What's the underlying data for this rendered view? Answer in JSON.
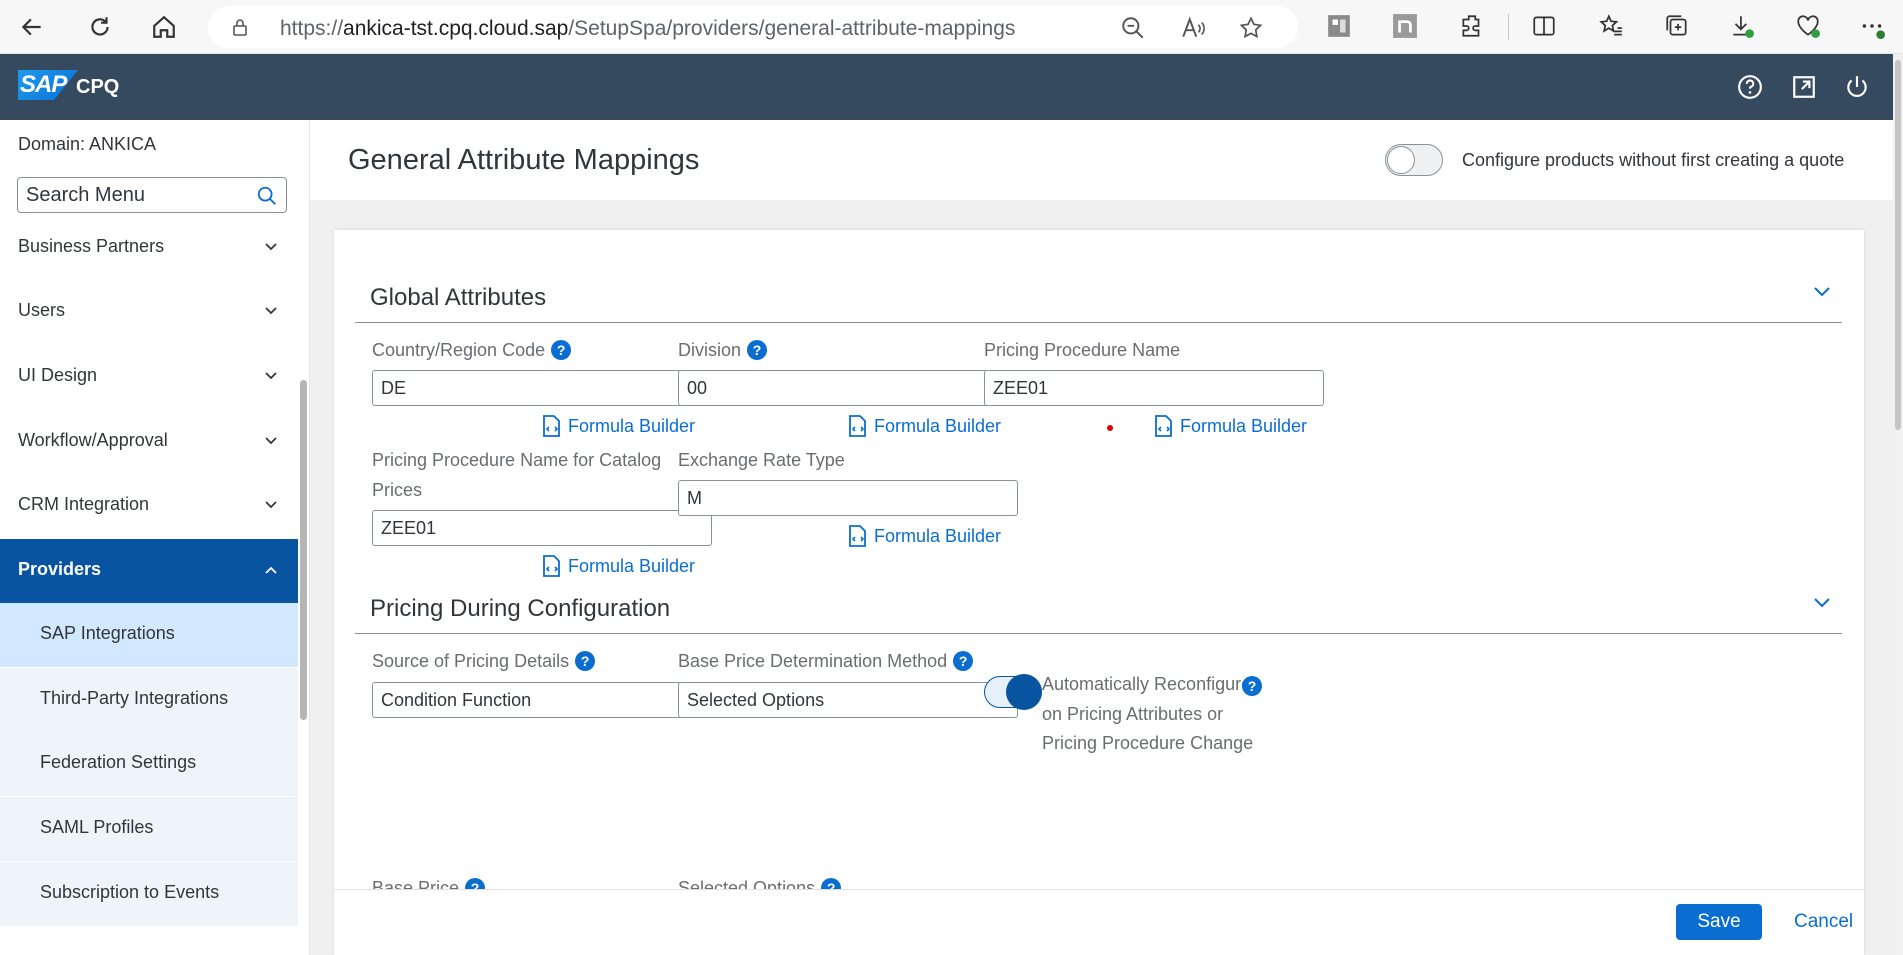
{
  "browser": {
    "url_prefix": "https://",
    "url_host": "ankica-tst.cpq.cloud.sap",
    "url_path": "/SetupSpa/providers/general-attribute-mappings"
  },
  "shell": {
    "logo": "SAP",
    "product": "CPQ"
  },
  "sidebar": {
    "domain": "Domain: ANKICA",
    "search_placeholder": "Search Menu",
    "items": [
      {
        "label": "Business Partners"
      },
      {
        "label": "Users"
      },
      {
        "label": "UI Design"
      },
      {
        "label": "Workflow/Approval"
      },
      {
        "label": "CRM Integration"
      },
      {
        "label": "Providers"
      },
      {
        "label": "SAP Integrations"
      },
      {
        "label": "Third-Party Integrations"
      },
      {
        "label": "Federation Settings"
      },
      {
        "label": "SAML Profiles"
      },
      {
        "label": "Subscription to Events"
      }
    ]
  },
  "main": {
    "title": "General Attribute Mappings",
    "configure_toggle_label": "Configure products without first creating a quote",
    "formula_builder": "Formula Builder",
    "global": {
      "title": "Global Attributes",
      "country_label": "Country/Region Code",
      "country_value": "DE",
      "division_label": "Division",
      "division_value": "00",
      "procedure_label": "Pricing Procedure Name",
      "procedure_value": "ZEE01",
      "catalog_label_1": "Pricing Procedure Name for Catalog",
      "catalog_label_2": "Prices",
      "catalog_value": "ZEE01",
      "exchange_label": "Exchange Rate Type",
      "exchange_value": "M"
    },
    "pricing": {
      "title": "Pricing During Configuration",
      "source_label": "Source of Pricing Details",
      "source_value": "Condition Function",
      "base_method_label": "Base Price Determination Method",
      "base_method_value": "Selected Options",
      "reconfigure_1": "Automatically Reconfigure",
      "reconfigure_2": "on Pricing Attributes or",
      "reconfigure_3": "Pricing Procedure Change",
      "base_price_label": "Base Price",
      "selected_options_label": "Selected Options"
    },
    "footer": {
      "save": "Save",
      "cancel": "Cancel"
    }
  },
  "colors": {
    "shell": "#354a5f",
    "accent": "#0a6ed1",
    "active_nav": "#0854a0",
    "selected_nav": "#d1e8ff"
  }
}
